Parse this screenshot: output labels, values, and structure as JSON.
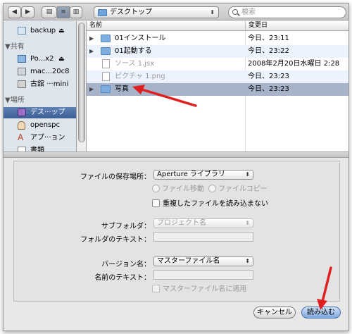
{
  "toolbar": {
    "back_label": "◀",
    "forward_label": "▶",
    "view_icons": "▤",
    "view_list": "≡",
    "view_columns": "▥",
    "location": "デスクトップ",
    "search_placeholder": "検索"
  },
  "sidebar": {
    "devices": [
      {
        "label": "backup",
        "eject": "⏏"
      }
    ],
    "shared_header": "▼共有",
    "shared": [
      {
        "label": "Po...x2",
        "eject": "⏏"
      },
      {
        "label": "mac...20c8"
      },
      {
        "label": "古舘 ···mini"
      }
    ],
    "places_header": "▼場所",
    "places": [
      {
        "label": "デス···ップ"
      },
      {
        "label": "openspc"
      },
      {
        "label": "アプ···ョン"
      },
      {
        "label": "書類"
      }
    ]
  },
  "filelist": {
    "col_name": "名前",
    "col_date": "変更日",
    "rows": [
      {
        "name": "01インストール",
        "date": "今日、23:11"
      },
      {
        "name": "01起動する",
        "date": "今日、23:22"
      },
      {
        "name": "ソース 1.jsx",
        "date": "2008年2月20日水曜日 2:28"
      },
      {
        "name": "ピクチャ 1.png",
        "date": "今日、23:23"
      },
      {
        "name": "写真",
        "date": "今日、23:23"
      }
    ]
  },
  "options": {
    "save_location_label": "ファイルの保存場所：",
    "save_location_value": "Aperture ライブラリ",
    "radio_move": "ファイル移動",
    "radio_copy": "ファイルコピー",
    "skip_duplicates": "重複したファイルを読み込まない",
    "subfolder_label": "サブフォルダ：",
    "subfolder_value": "プロジェクト名",
    "folder_text_label": "フォルダのテキスト：",
    "version_name_label": "バージョン名：",
    "version_name_value": "マスターファイル名",
    "name_text_label": "名前のテキスト：",
    "apply_master": "マスターファイル名に適用"
  },
  "buttons": {
    "cancel": "キャンセル",
    "import": "読み込む"
  },
  "colors": {
    "selection": "#a6b3c8",
    "arrow": "#e02020"
  }
}
